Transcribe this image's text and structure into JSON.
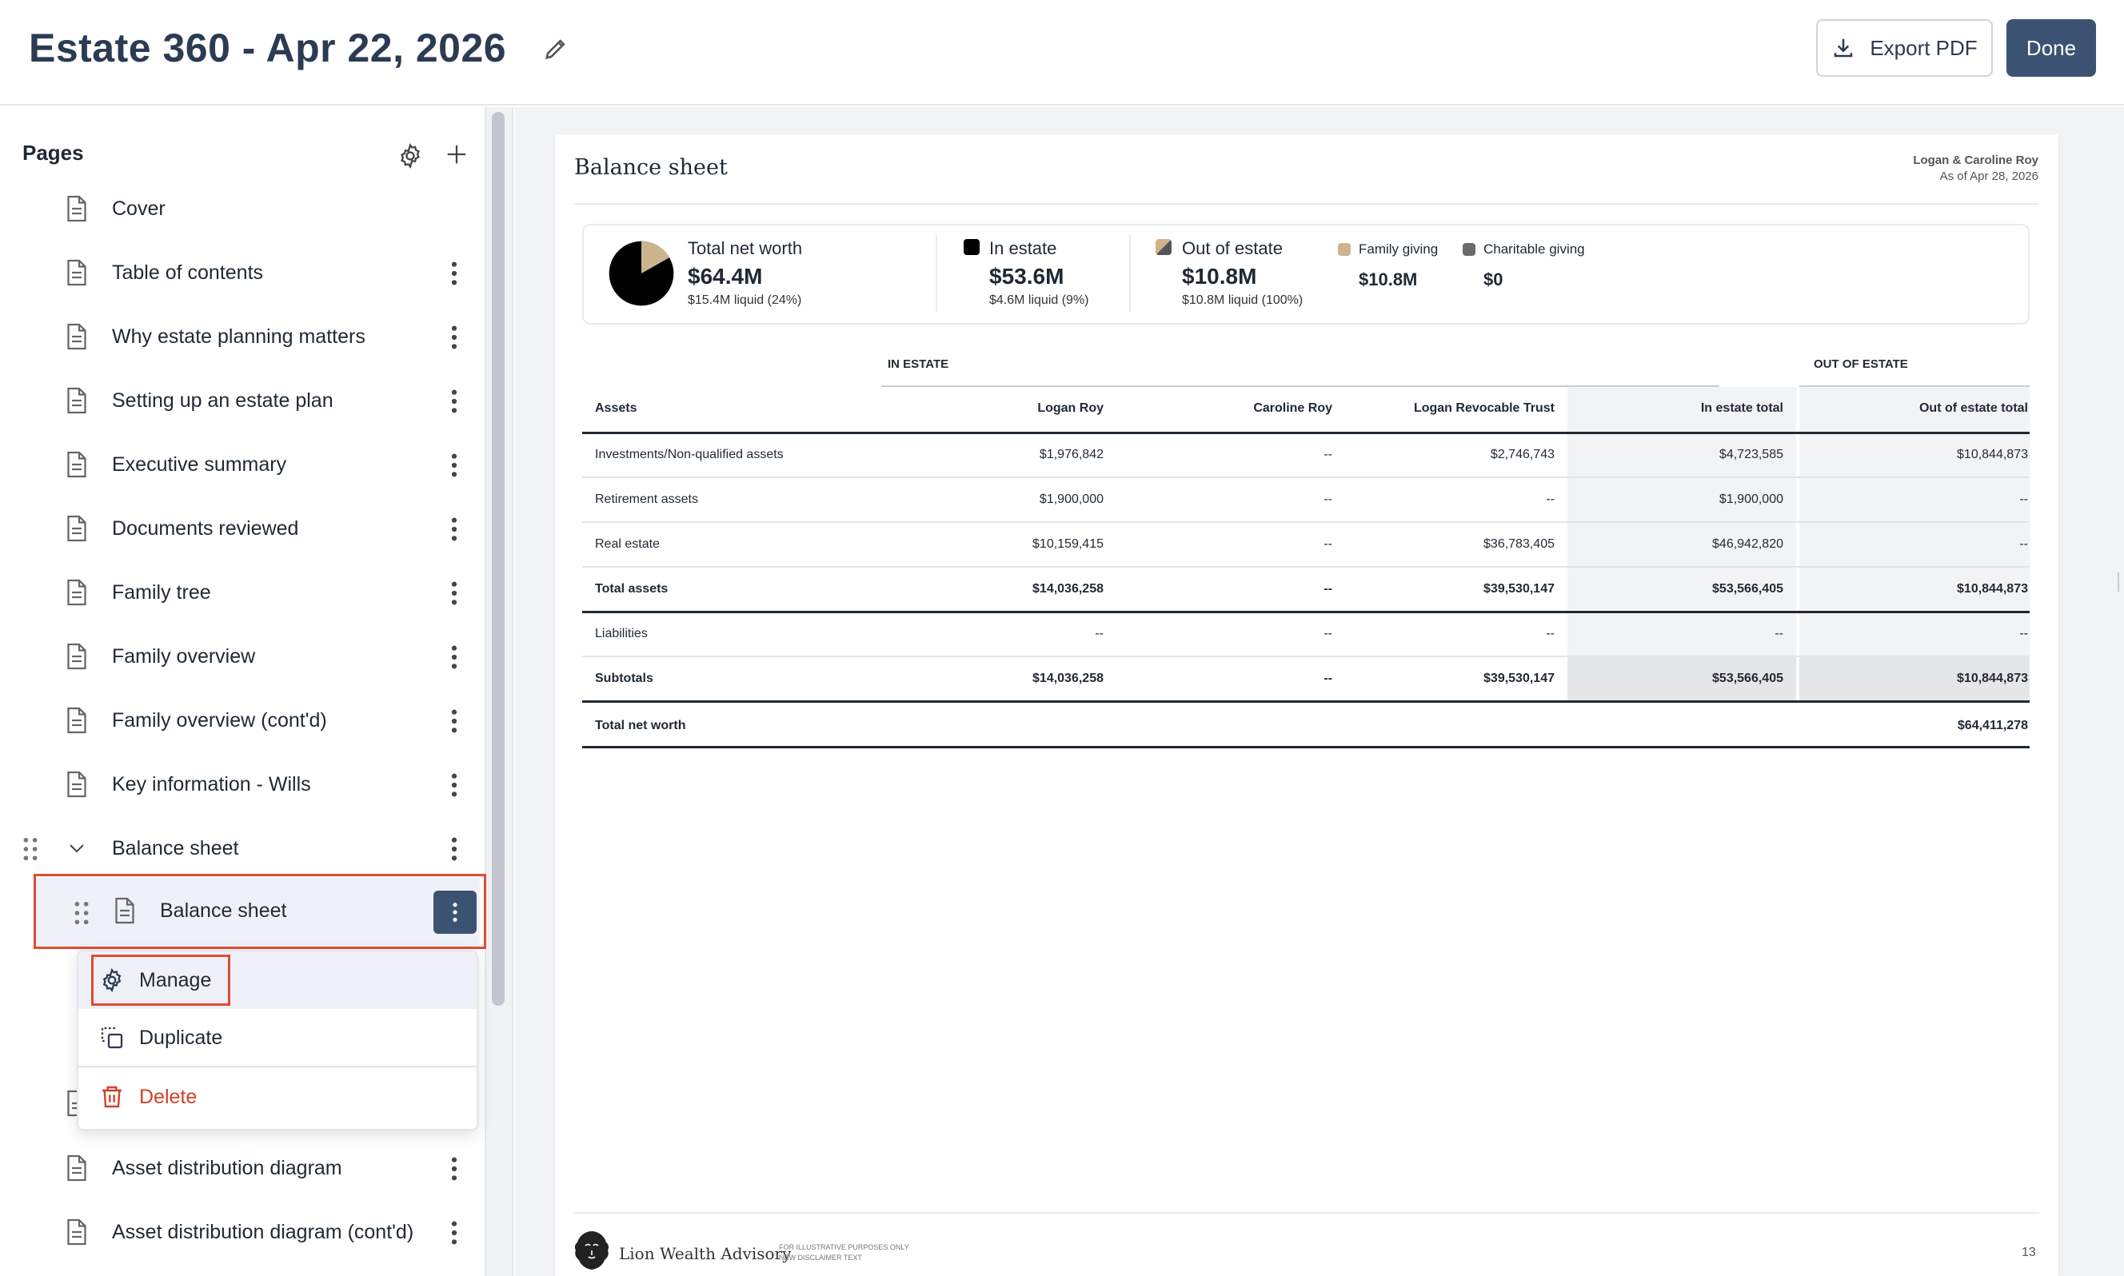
{
  "header": {
    "title": "Estate 360 - Apr 22, 2026",
    "export_label": "Export PDF",
    "done_label": "Done"
  },
  "sidebar": {
    "heading": "Pages",
    "items": [
      {
        "label": "Cover"
      },
      {
        "label": "Table of contents"
      },
      {
        "label": "Why estate planning matters"
      },
      {
        "label": "Setting up an estate plan"
      },
      {
        "label": "Executive summary"
      },
      {
        "label": "Documents reviewed"
      },
      {
        "label": "Family tree"
      },
      {
        "label": "Family overview"
      },
      {
        "label": "Family overview (cont'd)"
      },
      {
        "label": "Key information - Wills"
      }
    ],
    "group": {
      "label": "Balance sheet",
      "child": "Balance sheet"
    },
    "after_items": [
      {
        "label": "Asset distribution diagram"
      },
      {
        "label": "Asset distribution diagram (cont'd)"
      }
    ]
  },
  "menu": {
    "manage": "Manage",
    "duplicate": "Duplicate",
    "delete": "Delete"
  },
  "sheet": {
    "title": "Balance sheet",
    "client_name": "Logan & Caroline Roy",
    "as_of": "As of Apr 28, 2026",
    "summary": {
      "net_worth_label": "Total net worth",
      "net_worth_value": "$64.4M",
      "net_worth_sub": "$15.4M liquid (24%)",
      "in_estate_label": "In estate",
      "in_estate_value": "$53.6M",
      "in_estate_sub": "$4.6M liquid (9%)",
      "out_estate_label": "Out of estate",
      "out_estate_value": "$10.8M",
      "out_estate_sub": "$10.8M liquid (100%)",
      "family_label": "Family giving",
      "family_value": "$10.8M",
      "charity_label": "Charitable giving",
      "charity_value": "$0",
      "pie_in_estate_pct": 83.2
    },
    "table": {
      "group_in": "IN ESTATE",
      "group_out": "OUT OF ESTATE",
      "columns": [
        "Assets",
        "Logan Roy",
        "Caroline Roy",
        "Logan Revocable Trust",
        "In estate total",
        "Out of estate total"
      ],
      "rows": [
        [
          "Investments/Non-qualified assets",
          "$1,976,842",
          "--",
          "$2,746,743",
          "$4,723,585",
          "$10,844,873"
        ],
        [
          "Retirement assets",
          "$1,900,000",
          "--",
          "--",
          "$1,900,000",
          "--"
        ],
        [
          "Real estate",
          "$10,159,415",
          "--",
          "$36,783,405",
          "$46,942,820",
          "--"
        ],
        [
          "Total assets",
          "$14,036,258",
          "--",
          "$39,530,147",
          "$53,566,405",
          "$10,844,873"
        ],
        [
          "Liabilities",
          "--",
          "--",
          "--",
          "--",
          "--"
        ],
        [
          "Subtotals",
          "$14,036,258",
          "--",
          "$39,530,147",
          "$53,566,405",
          "$10,844,873"
        ]
      ],
      "net_worth_label": "Total net worth",
      "net_worth_value": "$64,411,278"
    },
    "footer": {
      "brand": "Lion Wealth Advisory",
      "disclaimer_1": "FOR ILLUSTRATIVE PURPOSES ONLY",
      "disclaimer_2": "NEW DISCLAIMER TEXT",
      "page_number": "13"
    }
  },
  "colors": {
    "primary": "#3c5272",
    "highlight": "#e34a2f",
    "danger": "#d2402a",
    "family_giving": "#cdb48f",
    "charitable_giving": "#6b6b6b"
  }
}
